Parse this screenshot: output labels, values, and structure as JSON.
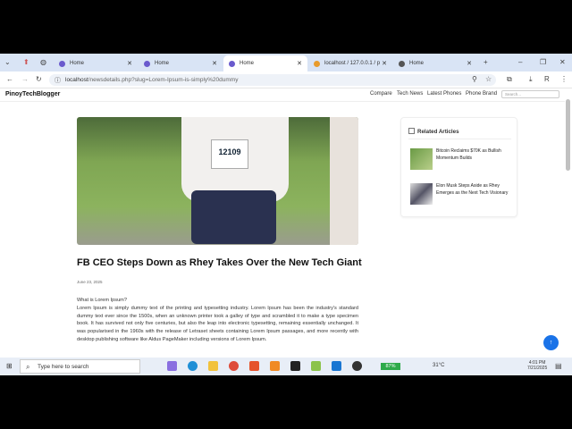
{
  "browser": {
    "tabs": [
      {
        "label": "Home"
      },
      {
        "label": "Home"
      },
      {
        "label": "Home",
        "active": true
      },
      {
        "label": "localhost / 127.0.0.1 / p"
      },
      {
        "label": "Home"
      }
    ],
    "url_host": "localhost",
    "url_path": "/newsdetails.php?slug=Lorem-Ipsum-is-simply%20dummy"
  },
  "site": {
    "brand": "PinoyTechBlogger",
    "nav": [
      "Compare",
      "Tech News",
      "Latest Phones",
      "Phone Brand"
    ],
    "search_placeholder": "Search..."
  },
  "article": {
    "title": "FB CEO Steps Down as Rhey Takes Over the New Tech Giant",
    "date": "June 23, 2025",
    "subheading": "What is Lorem Ipsum?",
    "body": "Lorem Ipsum is simply dummy text of the printing and typesetting industry. Lorem Ipsum has been the industry's standard dummy text ever since the 1500s, when an unknown printer took a galley of type and scrambled it to make a type specimen book. It has survived not only five centuries, but also the leap into electronic typesetting, remaining essentially unchanged. It was popularised in the 1960s with the release of Letraset sheets containing Lorem Ipsum passages, and more recently with desktop publishing software like Aldus PageMaker including versions of Lorem Ipsum.",
    "bib": "12109"
  },
  "related": {
    "heading": "Related Articles",
    "items": [
      {
        "title": "Bitcoin Reclaims $70K as Bullish Momentum Builds"
      },
      {
        "title": "Elon Musk Steps Aside as Rhey Emerges as the Next Tech Visionary"
      }
    ]
  },
  "taskbar": {
    "search_placeholder": "Type here to search",
    "battery": "87%",
    "weather": "31°C",
    "time": "4:01 PM",
    "date": "7/21/2025"
  }
}
